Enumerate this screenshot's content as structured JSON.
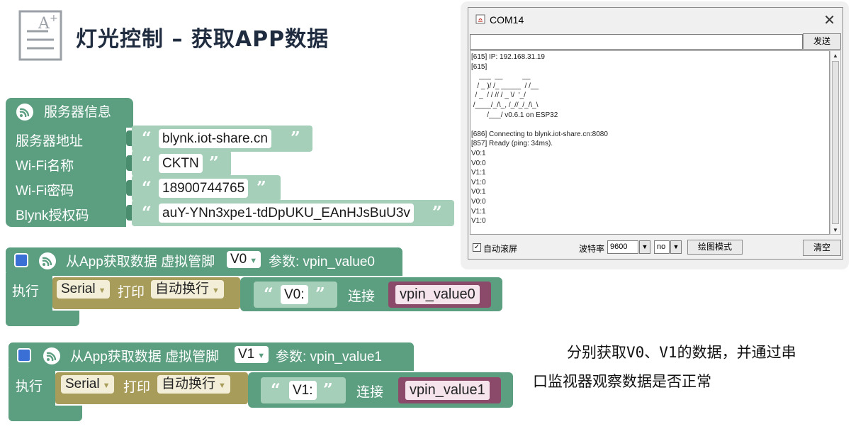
{
  "title": "灯光控制 – 获取APP数据",
  "server_block": {
    "header": "服务器信息",
    "rows": [
      {
        "label": "服务器地址",
        "value": "blynk.iot-share.cn"
      },
      {
        "label": "Wi-Fi名称",
        "value": "CKTN"
      },
      {
        "label": "Wi-Fi密码",
        "value": "18900744765"
      },
      {
        "label": "Blynk授权码",
        "value": "auY-YNn3xpe1-tdDpUKU_EAnHJsBuU3v"
      }
    ]
  },
  "event_blocks": [
    {
      "prefix": "从App获取数据 虚拟管脚",
      "pin": "V0",
      "param_label": "参数: vpin_value0",
      "exec": "执行",
      "serial": "Serial",
      "print": "打印",
      "newline": "自动换行",
      "string": "V0:",
      "join": "连接",
      "var": "vpin_value0"
    },
    {
      "prefix": "从App获取数据 虚拟管脚",
      "pin": "V1",
      "param_label": "参数: vpin_value1",
      "exec": "执行",
      "serial": "Serial",
      "print": "打印",
      "newline": "自动换行",
      "string": "V1:",
      "join": "连接",
      "var": "vpin_value1"
    }
  ],
  "serial_monitor": {
    "title": "COM14",
    "send_label": "发送",
    "console_lines": [
      "[615] IP: 192.168.31.19",
      "[615]",
      "    ___  __          __",
      "   / _ )/ /_ _____  / /__",
      "  / _  / / // / _ \\/  '_/",
      " /____/_/\\_, /_//_/_/\\_\\",
      "        /___/ v0.6.1 on ESP32",
      "",
      "[686] Connecting to blynk.iot-share.cn:8080",
      "[857] Ready (ping: 34ms).",
      "V0:1",
      "V0:0",
      "V1:1",
      "V1:0",
      "V0:1",
      "V0:0",
      "V1:1",
      "V1:0"
    ],
    "autoscroll_label": "自动滚屏",
    "autoscroll_checked": true,
    "baud_label": "波特率",
    "baud_value": "9600",
    "line_ending": "no",
    "plot_button": "绘图模式",
    "clear_button": "清空"
  },
  "note_lines": [
    "分别获取V0、V1的数据，并通过串",
    "口监视器观察数据是否正常"
  ],
  "colors": {
    "block_green": "#5b9e80",
    "string_block": "#a6cfb9",
    "serial_olive": "#a89c5a",
    "variable_magenta": "#8c4a6a",
    "title_dark": "#1f2b3e"
  }
}
